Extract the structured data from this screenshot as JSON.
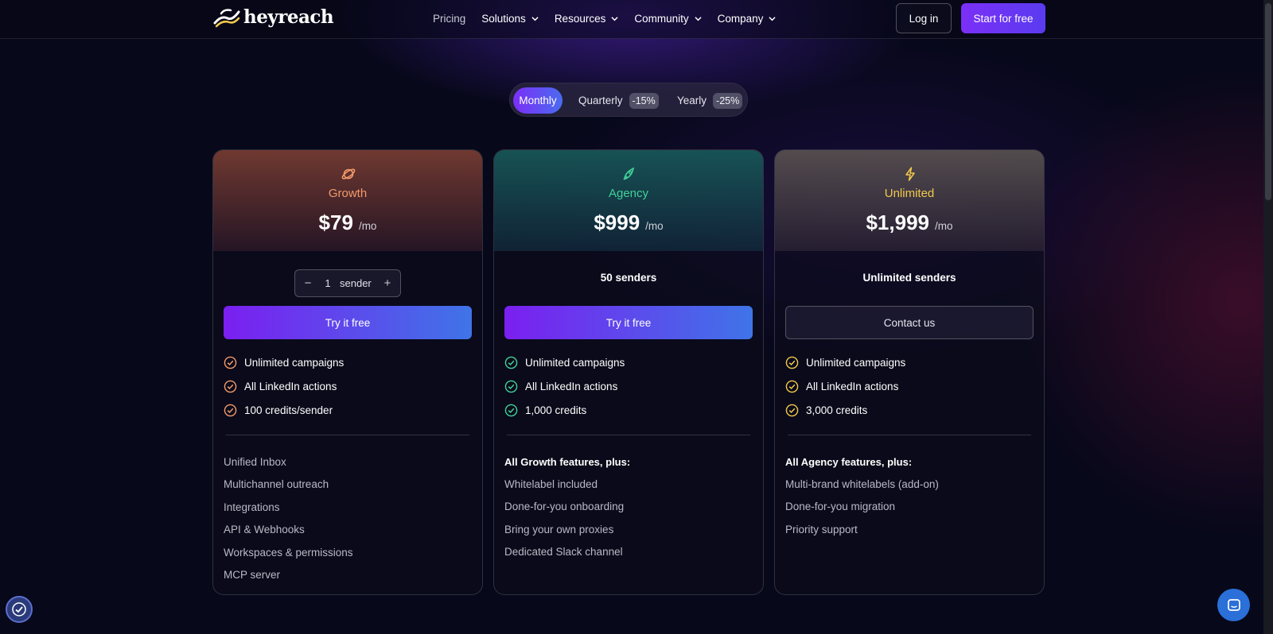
{
  "header": {
    "brand": "heyreach",
    "nav": [
      {
        "label": "Pricing",
        "dropdown": false
      },
      {
        "label": "Solutions",
        "dropdown": true
      },
      {
        "label": "Resources",
        "dropdown": true
      },
      {
        "label": "Community",
        "dropdown": true
      },
      {
        "label": "Company",
        "dropdown": true
      }
    ],
    "login_label": "Log in",
    "start_label": "Start for free"
  },
  "billing_toggle": {
    "options": [
      {
        "label": "Monthly",
        "badge": "",
        "selected": true
      },
      {
        "label": "Quarterly",
        "badge": "-15%",
        "selected": false
      },
      {
        "label": "Yearly",
        "badge": "-25%",
        "selected": false
      }
    ]
  },
  "plans": [
    {
      "name": "Growth",
      "icon": "planet-icon",
      "price": "$79",
      "period": "/mo",
      "stepper": {
        "value": "1",
        "unit": "sender",
        "minus": "−",
        "plus": "+"
      },
      "cta": "Try it free",
      "features": [
        "Unlimited campaigns",
        "All LinkedIn actions",
        "100 credits/sender"
      ],
      "extras_heading": "",
      "extras": [
        "Unified Inbox",
        "Multichannel outreach",
        "Integrations",
        "API & Webhooks",
        "Workspaces & permissions",
        "MCP server"
      ],
      "accent": "#f39a6a"
    },
    {
      "name": "Agency",
      "icon": "rocket-icon",
      "price": "$999",
      "period": "/mo",
      "senders": "50 senders",
      "cta": "Try it free",
      "features": [
        "Unlimited campaigns",
        "All LinkedIn actions",
        "1,000 credits"
      ],
      "extras_heading": "All Growth features, plus:",
      "extras": [
        "Whitelabel included",
        "Done-for-you onboarding",
        "Bring your own proxies",
        "Dedicated Slack channel"
      ],
      "accent": "#43d19a"
    },
    {
      "name": "Unlimited",
      "icon": "lightning-icon",
      "price": "$1,999",
      "period": "/mo",
      "senders": "Unlimited senders",
      "cta": "Contact us",
      "features": [
        "Unlimited campaigns",
        "All LinkedIn actions",
        "3,000 credits"
      ],
      "extras_heading": "All Agency features, plus:",
      "extras": [
        "Multi-brand whitelabels (add-on)",
        "Done-for-you migration",
        "Priority support"
      ],
      "accent": "#f2c94c"
    }
  ],
  "colors": {
    "cta_gradient_start": "#7b1ff0",
    "cta_gradient_end": "#3f74e8",
    "background": "#07081a"
  }
}
